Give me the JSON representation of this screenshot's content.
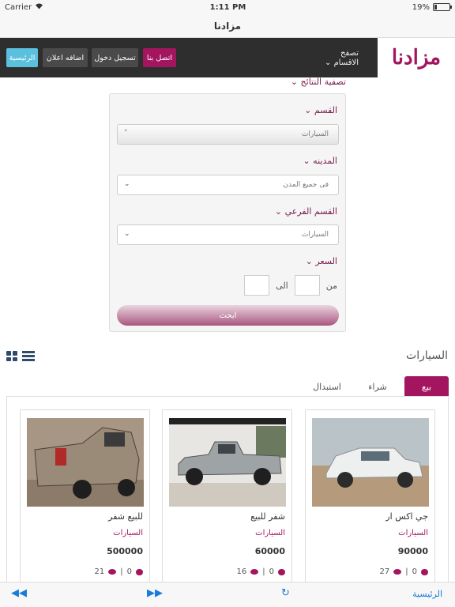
{
  "status": {
    "carrier": "Carrier",
    "time": "1:11 PM",
    "battery": "19%",
    "battery_level": 0.19
  },
  "nav": {
    "title": "مزادنا"
  },
  "header": {
    "logo": "مزادنا",
    "browse_line1": "تصفح",
    "browse_line2": "الاقسام",
    "home": "الرئيسية",
    "add_ad": "اضافه اعلان",
    "login": "تسجيل دخول",
    "contact": "اتصل بنا"
  },
  "filter": {
    "title": "تصفية النتائج",
    "category_label": "القسم",
    "category_value": "السيارات",
    "city_label": "المدينه",
    "city_value": "فى جميع المدن",
    "subcategory_label": "القسم الفرعي",
    "subcategory_value": "السيارات",
    "price_label": "السعر",
    "from": "من",
    "to": "الى",
    "search": "ابحث"
  },
  "section": {
    "title": "السيارات",
    "tabs": [
      "بيع",
      "شراء",
      "استبدال"
    ]
  },
  "listings": [
    {
      "title": "جي اكس ار",
      "category": "السيارات",
      "price": "90000",
      "comments": "0",
      "views": "27"
    },
    {
      "title": "شفر للبيع",
      "category": "السيارات",
      "price": "60000",
      "comments": "0",
      "views": "16"
    },
    {
      "title": "للبيع شفر",
      "category": "السيارات",
      "price": "500000",
      "comments": "0",
      "views": "21"
    }
  ],
  "toolbar": {
    "home": "الرئيسية"
  },
  "colors": {
    "brand": "#a3165f",
    "header": "#2e2e2e",
    "home_button": "#5bc0de"
  }
}
